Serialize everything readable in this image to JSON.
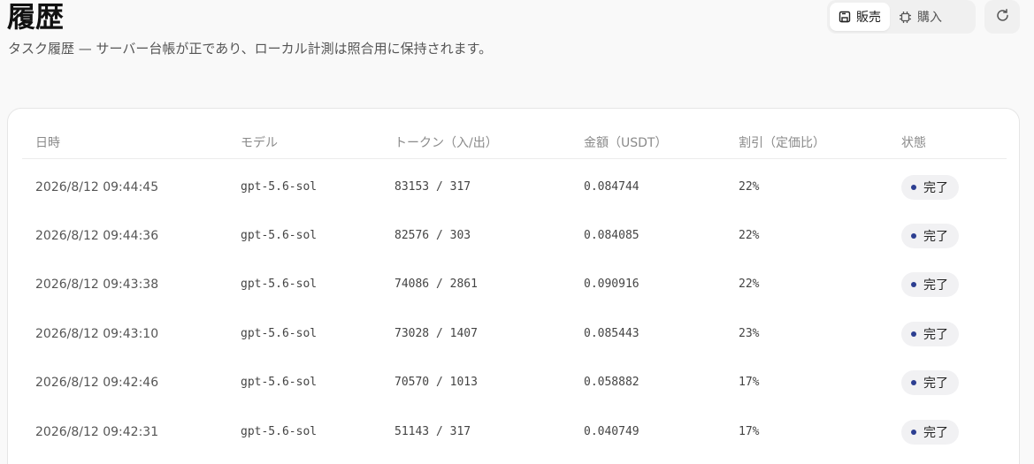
{
  "page": {
    "title": "履歴",
    "subtitle": "タスク履歴 — サーバー台帳が正であり、ローカル計測は照合用に保持されます。"
  },
  "toolbar": {
    "segments": [
      {
        "label": "販売",
        "icon": "save-icon",
        "active": true
      },
      {
        "label": "購入",
        "icon": "chip-icon",
        "active": false
      }
    ],
    "refresh_icon": "refresh-icon"
  },
  "table": {
    "headers": {
      "date": "日時",
      "model": "モデル",
      "tokens": "トークン（入/出）",
      "amount": "金額（USDT）",
      "discount": "割引（定価比）",
      "status": "状態"
    },
    "rows": [
      {
        "date": "2026/8/12 09:44:45",
        "model": "gpt-5.6-sol",
        "tokens": "83153 / 317",
        "amount": "0.084744",
        "discount": "22%",
        "status": "完了"
      },
      {
        "date": "2026/8/12 09:44:36",
        "model": "gpt-5.6-sol",
        "tokens": "82576 / 303",
        "amount": "0.084085",
        "discount": "22%",
        "status": "完了"
      },
      {
        "date": "2026/8/12 09:43:38",
        "model": "gpt-5.6-sol",
        "tokens": "74086 / 2861",
        "amount": "0.090916",
        "discount": "22%",
        "status": "完了"
      },
      {
        "date": "2026/8/12 09:43:10",
        "model": "gpt-5.6-sol",
        "tokens": "73028 / 1407",
        "amount": "0.085443",
        "discount": "23%",
        "status": "完了"
      },
      {
        "date": "2026/8/12 09:42:46",
        "model": "gpt-5.6-sol",
        "tokens": "70570 / 1013",
        "amount": "0.058882",
        "discount": "17%",
        "status": "完了"
      },
      {
        "date": "2026/8/12 09:42:31",
        "model": "gpt-5.6-sol",
        "tokens": "51143 / 317",
        "amount": "0.040749",
        "discount": "17%",
        "status": "完了"
      }
    ]
  },
  "colors": {
    "status_dot": "#2c3e91",
    "background": "#f9f9f9",
    "card": "#ffffff"
  }
}
